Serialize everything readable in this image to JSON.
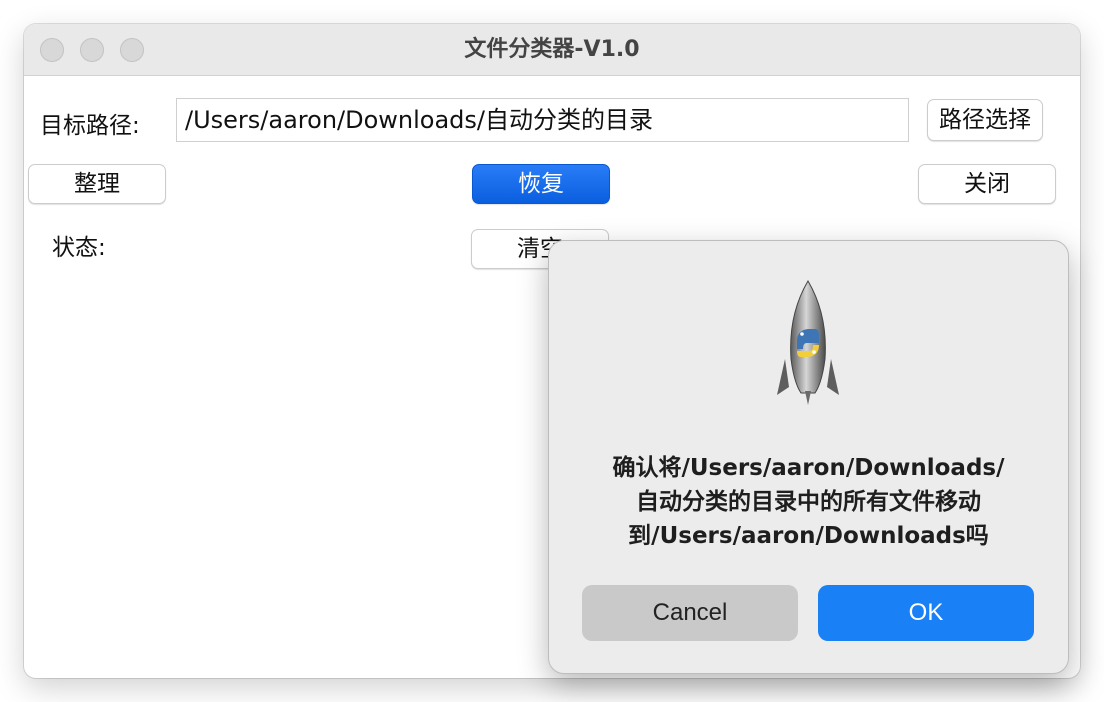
{
  "window": {
    "title": "文件分类器-V1.0"
  },
  "form": {
    "target_path_label": "目标路径:",
    "target_path_value": "/Users/aaron/Downloads/自动分类的目录",
    "choose_path_button": "路径选择",
    "organize_button": "整理",
    "restore_button": "恢复",
    "close_button": "关闭",
    "status_label": "状态:",
    "clear_button": "清空"
  },
  "dialog": {
    "message_lines": [
      "确认将/Users/aaron/Downloads/",
      "自动分类的目录中的所有文件移动",
      "到/Users/aaron/Downloads吗"
    ],
    "cancel_button": "Cancel",
    "ok_button": "OK",
    "icon": "python-launcher-rocket-icon"
  },
  "colors": {
    "primary": "#0a5fe0",
    "dialog_ok": "#1a80f5",
    "dialog_cancel": "#c9c9c9"
  }
}
